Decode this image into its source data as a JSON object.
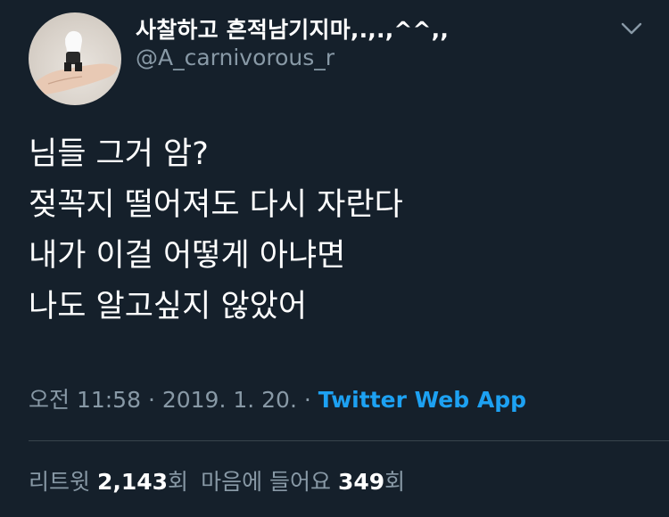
{
  "tweet": {
    "author": {
      "display_name": "사찰하고 흔적남기지마,.,.,^^,,",
      "handle": "@A_carnivorous_r"
    },
    "menu_icon": "chevron-down-icon",
    "text_lines": [
      "님들 그거 암?",
      "젖꼭지 떨어져도 다시 자란다",
      "내가 이걸 어떻게 아냐면",
      "나도 알고싶지 않았어"
    ],
    "timestamp": "오전 11:58 · 2019. 1. 20. ·",
    "source": "Twitter Web App",
    "stats": {
      "retweets_label": "리트윗",
      "retweets_count": "2,143",
      "retweets_suffix": "회",
      "likes_label": "마음에 들어요",
      "likes_count": "349",
      "likes_suffix": "회"
    }
  },
  "colors": {
    "background": "#15202b",
    "text": "#ffffff",
    "secondary": "#8899a6",
    "link": "#1da1f2",
    "divider": "#38444d"
  }
}
